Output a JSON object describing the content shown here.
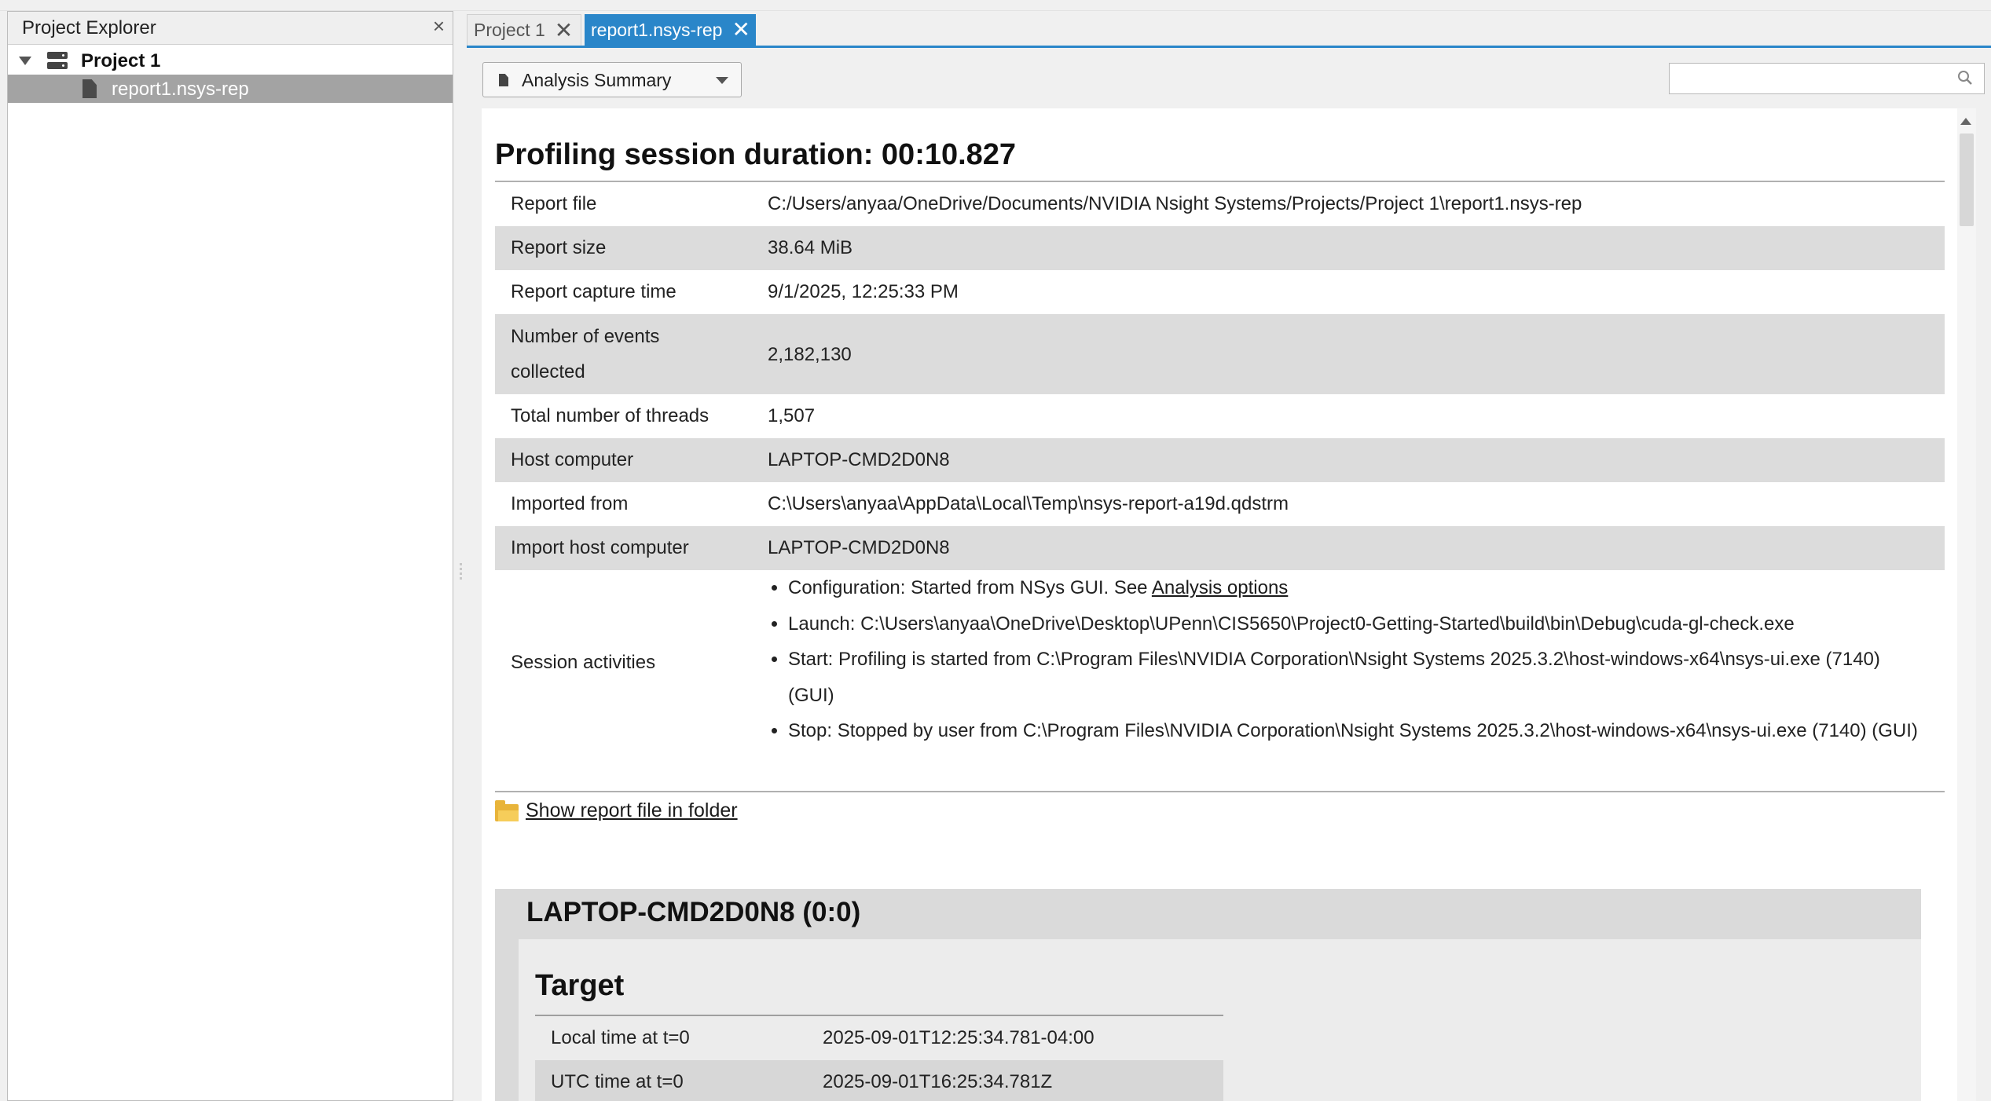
{
  "explorer": {
    "title": "Project Explorer",
    "project": "Project 1",
    "report": "report1.nsys-rep"
  },
  "tabs": [
    {
      "label": "Project 1"
    },
    {
      "label": "report1.nsys-rep"
    }
  ],
  "toolbar": {
    "view_selected": "Analysis Summary",
    "search_placeholder": ""
  },
  "summary": {
    "heading": "Profiling session duration: 00:10.827",
    "rows": [
      {
        "key": "Report file",
        "value": "C:/Users/anyaa/OneDrive/Documents/NVIDIA Nsight Systems/Projects/Project 1\\report1.nsys-rep"
      },
      {
        "key": "Report size",
        "value": "38.64 MiB"
      },
      {
        "key": "Report capture time",
        "value": "9/1/2025, 12:25:33 PM"
      },
      {
        "key": "Number of events collected",
        "value": "2,182,130"
      },
      {
        "key": "Total number of threads",
        "value": "1,507"
      },
      {
        "key": "Host computer",
        "value": "LAPTOP-CMD2D0N8"
      },
      {
        "key": "Imported from",
        "value": "C:\\Users\\anyaa\\AppData\\Local\\Temp\\nsys-report-a19d.qdstrm"
      },
      {
        "key": "Import host computer",
        "value": "LAPTOP-CMD2D0N8"
      }
    ],
    "session_activities": {
      "key": "Session activities",
      "config_prefix": "Configuration: Started from NSys GUI. See ",
      "config_link": "Analysis options",
      "launch": "Launch: C:\\Users\\anyaa\\OneDrive\\Desktop\\UPenn\\CIS5650\\Project0-Getting-Started\\build\\bin\\Debug\\cuda-gl-check.exe",
      "start": "Start: Profiling is started from C:\\Program Files\\NVIDIA Corporation\\Nsight Systems 2025.3.2\\host-windows-x64\\nsys-ui.exe (7140) (GUI)",
      "stop": "Stop: Stopped by user from C:\\Program Files\\NVIDIA Corporation\\Nsight Systems 2025.3.2\\host-windows-x64\\nsys-ui.exe (7140) (GUI)"
    },
    "folder_link": "Show report file in folder"
  },
  "host": {
    "title": "LAPTOP-CMD2D0N8 (0:0)",
    "target_heading": "Target",
    "rows": [
      {
        "key": "Local time at t=0",
        "value": "2025-09-01T12:25:34.781-04:00"
      },
      {
        "key": "UTC time at t=0",
        "value": "2025-09-01T16:25:34.781Z"
      }
    ]
  }
}
